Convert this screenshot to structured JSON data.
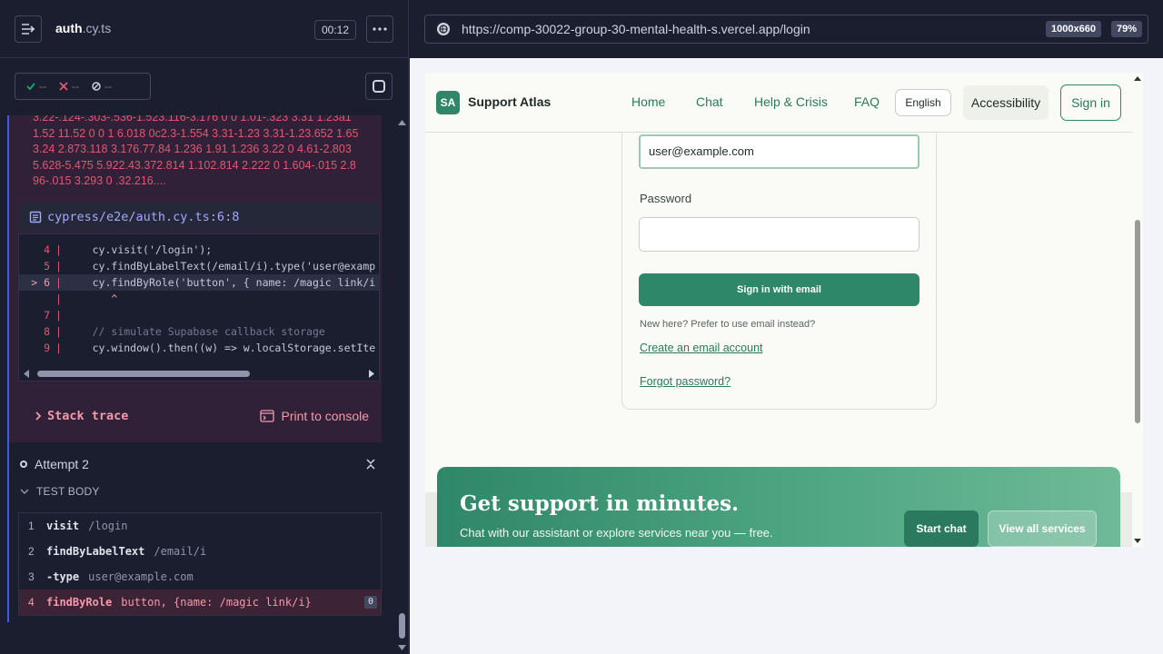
{
  "runner": {
    "spec_name_bold": "auth",
    "spec_name_ext": ".cy.ts",
    "timer": "00:12",
    "stats": {
      "passed": "--",
      "failed": "--",
      "pending": "--"
    },
    "error_text": "3.22-.124-.303-.536-1.523.116-3.176 0 0 1.01-.323 3.31 1.23a11.52 11.52 0 0 1 6.018 0c2.3-1.554 3.31-1.23 3.31-1.23.652 1.653.24 2.873.118 3.176.77.84 1.236 1.91 1.236 3.22 0 4.61-2.803 5.628-5.475 5.922.43.372.814 1.102.814 2.222 0 1.604-.015 2.896-.015 3.293 0 .32.216....",
    "file_link": "cypress/e2e/auth.cy.ts:6:8",
    "code": [
      {
        "ln": "4",
        "text": "    cy.visit('/login');"
      },
      {
        "ln": "5",
        "text": "    cy.findByLabelText(/email/i).type('user@examp"
      },
      {
        "ln": "> 6",
        "text": "    cy.findByRole('button', { name: /magic link/i"
      },
      {
        "ln": "",
        "text": "       ^"
      },
      {
        "ln": "7",
        "text": ""
      },
      {
        "ln": "8",
        "text": "    // simulate Supabase callback storage"
      },
      {
        "ln": "9",
        "text": "    cy.window().then((w) => w.localStorage.setIte"
      }
    ],
    "stack_trace_label": "Stack trace",
    "print_label": "Print to console",
    "attempt_label": "Attempt 2",
    "test_body_label": "TEST BODY",
    "commands": [
      {
        "num": "1",
        "name": "visit",
        "arg": "/login"
      },
      {
        "num": "2",
        "name": "findByLabelText",
        "arg": "/email/i"
      },
      {
        "num": "3",
        "name": "-type",
        "arg": "user@example.com"
      },
      {
        "num": "4",
        "name": "findByRole",
        "arg": "button, {name: /magic link/i}",
        "badge": "0"
      }
    ]
  },
  "browser": {
    "url": "https://comp-30022-group-30-mental-health-s.vercel.app/login",
    "viewport": "1000x660",
    "zoom": "79%"
  },
  "site": {
    "logo": "SA",
    "brand": "Support Atlas",
    "nav": [
      "Home",
      "Chat",
      "Help & Crisis",
      "FAQ"
    ],
    "language": "English",
    "accessibility": "Accessibility",
    "sign_in": "Sign in",
    "email_value": "user@example.com",
    "password_label": "Password",
    "submit_label": "Sign in with email",
    "new_here": "New here? Prefer to use email instead?",
    "create_account": "Create an email account",
    "forgot_password": "Forgot password?",
    "cta_title": "Get support in minutes.",
    "cta_sub": "Chat with our assistant or explore services near you — free.",
    "cta_start": "Start chat",
    "cta_view": "View all services"
  }
}
